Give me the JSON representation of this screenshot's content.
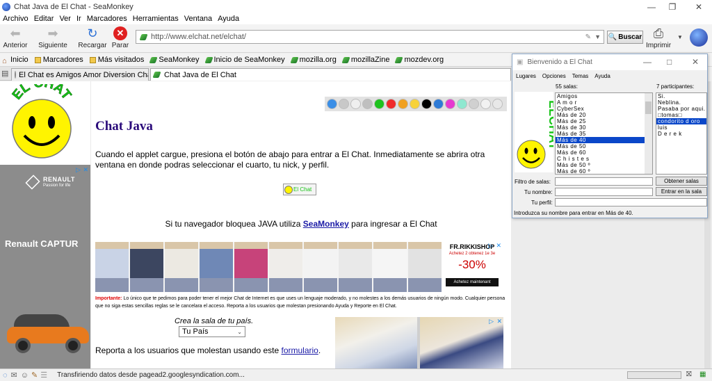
{
  "window": {
    "title": "Chat Java de El Chat - SeaMonkey"
  },
  "menu": [
    "Archivo",
    "Editar",
    "Ver",
    "Ir",
    "Marcadores",
    "Herramientas",
    "Ventana",
    "Ayuda"
  ],
  "toolbar": {
    "back": "Anterior",
    "forward": "Siguiente",
    "reload": "Recargar",
    "stop": "Parar",
    "url": "http://www.elchat.net/elchat/",
    "search": "Buscar",
    "print": "Imprimir"
  },
  "bookmarks": [
    "Inicio",
    "Marcadores",
    "Más visitados",
    "SeaMonkey",
    "Inicio de SeaMonkey",
    "mozilla.org",
    "mozillaZine",
    "mozdev.org"
  ],
  "tabs": [
    "El Chat es Amigos Amor Diversion Charl...",
    "Chat Java de El Chat"
  ],
  "page": {
    "logo_text": "EL CHAT",
    "title": "Chat Java",
    "intro": "Cuando el applet cargue, presiona el botón de abajo para entrar a El Chat. Inmediatamente se abrira otra ventana en donde podras seleccionar el cuarto, tu nick, y perfil.",
    "enter_button": "El Chat",
    "block_prefix": "Si tu navegador bloquea JAVA utiliza ",
    "block_link": "SeaMonkey",
    "block_suffix": " para ingresar a El Chat",
    "important_label": "Importante:",
    "important_text": " Lo único que te pedimos para poder tener el mejor Chat de Internet es que uses un lenguaje moderado, y no molestes a los demás usuarios de ningún modo. Cualquier persona que no siga estas sencillas reglas se le cancelara el acceso. Reporta a los usuarios que molestan presionando Ayuda y Reporte en El Chat.",
    "country_label": "Crea la sala de tu país.",
    "country_select": "Tu País",
    "report_prefix": "Reporta a los usuarios que molestan usando este ",
    "report_link": "formulario",
    "report_suffix": "."
  },
  "ad_left": {
    "brand": "RENAULT",
    "tagline": "Passion for life",
    "model": "Renault CAPTUR"
  },
  "ad_banner": {
    "brand": "FR.RIKKISHOP",
    "offer": "Achetez 2 obtenez 1e 3e",
    "discount": "-30%",
    "cta": "Achetez maintenant"
  },
  "color_dots": [
    "#3a8ee6",
    "#c8c8c8",
    "#efefef",
    "#bfbfbf",
    "#1ec21e",
    "#f02a2a",
    "#f0a020",
    "#f7d23a",
    "#000000",
    "#2f7bd6",
    "#e63ad0",
    "#8fe8d0",
    "#d0d0d0",
    "#f2f2f2",
    "#e8e8e8"
  ],
  "java": {
    "title": "Bienvenido a El Chat",
    "menu": [
      "Lugares",
      "Opciones",
      "Temas",
      "Ayuda"
    ],
    "logo_text": "ELCHAT",
    "rooms_label": "55 salas:",
    "rooms": [
      "Amigos",
      "A m o r",
      "CyberSex",
      "Más de 20",
      "Más de 25",
      "Más de 30",
      "Más de 35",
      "Más de 40",
      "Más de 50",
      "Más de 60",
      "C h i s t e s",
      "Más de 50 º",
      "Más de 60 º"
    ],
    "selected_room": "Más de 40",
    "participants_label": "7 participantes:",
    "participants": [
      "Si.",
      "Neblina.",
      "Pasaba por aqui.",
      "□tomas□",
      "condorito d oro",
      "luis",
      "D e r e k"
    ],
    "selected_participant": "condorito d oro",
    "filter_label": "Filtro de salas:",
    "get_rooms_button": "Obtener salas",
    "name_label": "Tu nombre:",
    "enter_room_button": "Entrar en la sala",
    "profile_label": "Tu perfil:",
    "hint": "Introduzca su nombre para entrar en Más de 40."
  },
  "status": {
    "text": "Transfiriendo datos desde pagead2.googlesyndication.com..."
  }
}
